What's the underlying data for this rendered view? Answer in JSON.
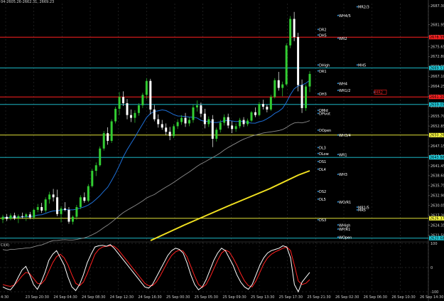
{
  "header": {
    "symbol_text": "04-2605.26-2662.31, 2669.23"
  },
  "subwindow": {
    "label": "CI(4)",
    "ticks": [
      "100",
      "0",
      "-100"
    ]
  },
  "colors": {
    "background": "#000000",
    "bull": "#32cd32",
    "bear": "#ffffff",
    "ma_fast": "#1e6fd6",
    "ma_slow": "#8c8c8c",
    "ma_long": "#f0e020",
    "red_line": "#ff2020",
    "cyan_line": "#20d0e0",
    "yellow_line": "#ffff40",
    "osc_main": "#ffffff",
    "osc_signal": "#ff2020"
  },
  "price_axis": {
    "max": 2688.0,
    "min": 2620.0,
    "ticks": [
      "2687.30",
      "2681.95",
      "2678.60",
      "2675.65",
      "2672.80",
      "2669.95",
      "2667.10",
      "2664.25",
      "2661.40",
      "2658.55",
      "2655.70",
      "2652.85",
      "2650.00",
      "2647.15",
      "2644.30",
      "2641.45",
      "2638.60",
      "2635.75",
      "2632.90",
      "2630.05",
      "2627.20",
      "2624.35",
      "2621.50"
    ],
    "marked": [
      {
        "label": "2678.35",
        "color": "#ff2020"
      },
      {
        "label": "2669.51",
        "color": "#20d0e0"
      },
      {
        "label": "2661.20",
        "color": "#ff2020"
      },
      {
        "label": "2659.05",
        "color": "#20d0e0"
      },
      {
        "label": "2650.26",
        "color": "#ffff40"
      },
      {
        "label": "2643.86",
        "color": "#20d0e0"
      },
      {
        "label": "2626.37",
        "color": "#ffff40"
      },
      {
        "label": "2620.68",
        "color": "#20d0e0"
      }
    ]
  },
  "time_axis": [
    "4:30",
    "23 Sep 20:30",
    "24 Sep 04:30",
    "24 Sep 08:30",
    "24 Sep 12:30",
    "24 Sep 16:30",
    "25 Sep 00:30",
    "25 Sep 05:30",
    "25 Sep 09:30",
    "25 Sep 13:30",
    "25 Sep 17:30",
    "25 Sep 21:30",
    "26 Sep 02:30",
    "26 Sep 06:30",
    "26 Sep 10:30",
    "26 Sep 14:30"
  ],
  "levels": [
    {
      "name": "WR2",
      "price": 2678.35,
      "color": "#ff2020",
      "label": "WR2"
    },
    {
      "name": "High",
      "price": 2669.51,
      "color": "#20d0e0",
      "label": "DHigh"
    },
    {
      "name": "R1",
      "price": 2661.2,
      "color": "#ff2020",
      "label": "DR1"
    },
    {
      "name": "cyan2",
      "price": 2659.05,
      "color": "#20d0e0",
      "label": "DH3"
    },
    {
      "name": "Open",
      "price": 2650.26,
      "color": "#ffff40",
      "label": "DOpen"
    },
    {
      "name": "WH3",
      "price": 2643.86,
      "color": "#20d0e0",
      "label": "WH3"
    },
    {
      "name": "yellow2",
      "price": 2626.37,
      "color": "#ffff40",
      "label": "DS3"
    },
    {
      "name": "WOpen",
      "price": 2620.68,
      "color": "#20d0e0",
      "label": "WOpen"
    }
  ],
  "annotations": [
    {
      "text": "WH4/5",
      "price": 2684.5,
      "col": "a",
      "color": "#ffffff"
    },
    {
      "text": "MR2/3",
      "price": 2687.0,
      "col": "c",
      "color": "#ffffff"
    },
    {
      "text": "DR2",
      "price": 2680.5,
      "col": "l",
      "color": "#ffffff"
    },
    {
      "text": "DH5",
      "price": 2678.9,
      "col": "l",
      "color": "#ffffff"
    },
    {
      "text": "WR2",
      "price": 2678.0,
      "col": "a",
      "color": "#ffffff"
    },
    {
      "text": "DHigh",
      "price": 2670.3,
      "col": "l",
      "color": "#ffffff"
    },
    {
      "text": "MH5",
      "price": 2670.3,
      "col": "c",
      "color": "#ffffff"
    },
    {
      "text": "DR1",
      "price": 2668.6,
      "col": "l",
      "color": "#ffffff"
    },
    {
      "text": "WH4",
      "price": 2665.0,
      "col": "a",
      "color": "#ffffff"
    },
    {
      "text": "WR1/2",
      "price": 2663.0,
      "col": "a",
      "color": "#ffffff"
    },
    {
      "text": "MR2",
      "price": 2662.5,
      "col": "d",
      "color": "#ff2020"
    },
    {
      "text": "DH3",
      "price": 2662.0,
      "col": "l",
      "color": "#ffffff"
    },
    {
      "text": "DMid",
      "price": 2657.3,
      "col": "l",
      "color": "#ffffff"
    },
    {
      "text": "DPivot",
      "price": 2656.4,
      "col": "l",
      "color": "#ffffff"
    },
    {
      "text": "DOpen",
      "price": 2651.6,
      "col": "l",
      "color": "#ffffff"
    },
    {
      "text": "WH3/4",
      "price": 2650.2,
      "col": "a",
      "color": "#ffffff"
    },
    {
      "text": "DL3",
      "price": 2646.6,
      "col": "l",
      "color": "#ffffff"
    },
    {
      "text": "DLow",
      "price": 2644.9,
      "col": "l",
      "color": "#ffffff"
    },
    {
      "text": "WR1",
      "price": 2644.6,
      "col": "a",
      "color": "#ffffff"
    },
    {
      "text": "DS1",
      "price": 2642.6,
      "col": "l",
      "color": "#ffffff"
    },
    {
      "text": "DL4",
      "price": 2640.4,
      "col": "l",
      "color": "#ffffff"
    },
    {
      "text": "WH3",
      "price": 2638.9,
      "col": "a",
      "color": "#ffffff"
    },
    {
      "text": "DS2",
      "price": 2634.0,
      "col": "l",
      "color": "#ffffff"
    },
    {
      "text": "DL5",
      "price": 2631.8,
      "col": "l",
      "color": "#ffffff"
    },
    {
      "text": "WO/R1",
      "price": 2631.0,
      "col": "a",
      "color": "#ffffff"
    },
    {
      "text": "MR1/5",
      "price": 2629.5,
      "col": "c",
      "color": "#ffffff"
    },
    {
      "text": "MR5",
      "price": 2628.7,
      "col": "c",
      "color": "#ffffff"
    },
    {
      "text": "DS3",
      "price": 2625.9,
      "col": "l",
      "color": "#ffffff"
    },
    {
      "text": "WHigh",
      "price": 2624.4,
      "col": "a",
      "color": "#ffffff"
    },
    {
      "text": "WP/R1",
      "price": 2623.2,
      "col": "a",
      "color": "#ffffff"
    },
    {
      "text": "WOpen",
      "price": 2620.9,
      "col": "a",
      "color": "#ffffff"
    }
  ],
  "candles": [
    [
      2626.0,
      2627.4,
      2625.0,
      2626.8
    ],
    [
      2626.8,
      2627.6,
      2625.6,
      2626.2
    ],
    [
      2626.2,
      2627.8,
      2625.8,
      2627.2
    ],
    [
      2627.2,
      2628.0,
      2625.9,
      2626.4
    ],
    [
      2626.4,
      2627.5,
      2625.0,
      2627.0
    ],
    [
      2627.0,
      2628.0,
      2626.3,
      2626.8
    ],
    [
      2626.8,
      2627.9,
      2625.6,
      2627.5
    ],
    [
      2627.5,
      2628.2,
      2626.1,
      2626.6
    ],
    [
      2626.6,
      2629.2,
      2626.0,
      2628.8
    ],
    [
      2628.8,
      2630.5,
      2628.1,
      2629.6
    ],
    [
      2629.6,
      2630.8,
      2627.9,
      2628.6
    ],
    [
      2628.6,
      2632.4,
      2628.0,
      2631.8
    ],
    [
      2631.8,
      2634.0,
      2630.6,
      2633.2
    ],
    [
      2633.2,
      2634.8,
      2631.2,
      2632.4
    ],
    [
      2632.4,
      2634.6,
      2627.0,
      2627.6
    ],
    [
      2627.6,
      2629.8,
      2625.2,
      2629.2
    ],
    [
      2629.2,
      2631.0,
      2628.4,
      2628.8
    ],
    [
      2628.8,
      2629.6,
      2624.8,
      2625.4
    ],
    [
      2625.4,
      2627.2,
      2624.6,
      2626.8
    ],
    [
      2626.8,
      2630.2,
      2626.0,
      2629.6
    ],
    [
      2629.6,
      2633.0,
      2629.0,
      2632.4
    ],
    [
      2632.4,
      2633.8,
      2630.8,
      2631.4
    ],
    [
      2631.4,
      2636.2,
      2631.0,
      2635.6
    ],
    [
      2635.6,
      2640.6,
      2635.2,
      2640.0
    ],
    [
      2640.0,
      2642.4,
      2638.5,
      2641.6
    ],
    [
      2641.6,
      2647.0,
      2641.2,
      2646.4
    ],
    [
      2646.4,
      2651.4,
      2645.8,
      2650.8
    ],
    [
      2650.8,
      2652.5,
      2647.5,
      2648.6
    ],
    [
      2648.6,
      2654.8,
      2648.0,
      2654.2
    ],
    [
      2654.2,
      2658.4,
      2653.6,
      2657.8
    ],
    [
      2657.8,
      2662.6,
      2656.0,
      2661.2
    ],
    [
      2661.2,
      2662.8,
      2658.6,
      2659.4
    ],
    [
      2659.4,
      2660.6,
      2654.8,
      2656.0
    ],
    [
      2656.0,
      2657.6,
      2654.0,
      2655.2
    ],
    [
      2655.2,
      2657.4,
      2653.8,
      2656.6
    ],
    [
      2656.6,
      2659.4,
      2655.8,
      2658.8
    ],
    [
      2658.8,
      2662.4,
      2658.0,
      2661.8
    ],
    [
      2661.8,
      2666.6,
      2660.6,
      2665.8
    ],
    [
      2665.8,
      2666.4,
      2656.2,
      2657.6
    ],
    [
      2657.6,
      2658.9,
      2654.2,
      2654.8
    ],
    [
      2654.8,
      2656.2,
      2652.4,
      2653.4
    ],
    [
      2653.4,
      2654.6,
      2651.8,
      2652.4
    ],
    [
      2652.4,
      2653.6,
      2650.2,
      2651.2
    ],
    [
      2651.2,
      2652.6,
      2648.8,
      2650.0
    ],
    [
      2650.0,
      2653.4,
      2649.4,
      2652.8
    ],
    [
      2652.8,
      2654.8,
      2652.0,
      2654.0
    ],
    [
      2654.0,
      2656.0,
      2653.2,
      2655.2
    ],
    [
      2655.2,
      2656.6,
      2652.6,
      2653.6
    ],
    [
      2653.6,
      2655.4,
      2652.8,
      2654.6
    ],
    [
      2654.6,
      2659.0,
      2653.8,
      2658.2
    ],
    [
      2658.2,
      2660.2,
      2657.0,
      2658.8
    ],
    [
      2658.8,
      2659.6,
      2655.4,
      2656.4
    ],
    [
      2656.4,
      2657.8,
      2652.2,
      2653.4
    ],
    [
      2653.4,
      2655.6,
      2652.6,
      2654.8
    ],
    [
      2654.8,
      2656.0,
      2646.8,
      2649.2
    ],
    [
      2649.2,
      2652.4,
      2648.4,
      2651.8
    ],
    [
      2651.8,
      2654.6,
      2651.0,
      2653.8
    ],
    [
      2653.8,
      2656.2,
      2653.0,
      2655.4
    ],
    [
      2655.4,
      2656.4,
      2652.2,
      2653.0
    ],
    [
      2653.0,
      2654.2,
      2650.8,
      2652.0
    ],
    [
      2652.0,
      2653.6,
      2651.2,
      2652.8
    ],
    [
      2652.8,
      2655.2,
      2652.2,
      2654.6
    ],
    [
      2654.6,
      2655.4,
      2652.6,
      2653.4
    ],
    [
      2653.4,
      2655.0,
      2652.8,
      2654.4
    ],
    [
      2654.4,
      2657.2,
      2654.0,
      2656.8
    ],
    [
      2656.8,
      2658.2,
      2655.4,
      2656.0
    ],
    [
      2656.0,
      2659.8,
      2655.6,
      2659.2
    ],
    [
      2659.2,
      2660.4,
      2657.6,
      2658.4
    ],
    [
      2658.4,
      2659.0,
      2656.8,
      2657.6
    ],
    [
      2657.6,
      2661.8,
      2657.2,
      2661.2
    ],
    [
      2661.2,
      2666.6,
      2660.8,
      2666.0
    ],
    [
      2666.0,
      2668.4,
      2663.0,
      2663.8
    ],
    [
      2663.8,
      2665.6,
      2661.4,
      2664.8
    ],
    [
      2664.8,
      2676.6,
      2664.4,
      2676.0
    ],
    [
      2676.0,
      2684.4,
      2675.2,
      2683.6
    ],
    [
      2683.6,
      2685.6,
      2677.2,
      2678.4
    ],
    [
      2678.4,
      2679.6,
      2662.8,
      2664.6
    ],
    [
      2664.6,
      2666.2,
      2656.6,
      2658.0
    ],
    [
      2658.0,
      2664.8,
      2657.2,
      2664.2
    ],
    [
      2664.2,
      2668.6,
      2662.6,
      2667.8
    ]
  ],
  "osc": [
    -80,
    -88,
    -92,
    -72,
    -40,
    -10,
    5,
    -30,
    -70,
    -90,
    -60,
    -20,
    30,
    55,
    70,
    40,
    10,
    -40,
    -80,
    -95,
    -70,
    -30,
    20,
    55,
    85,
    90,
    92,
    88,
    95,
    80,
    60,
    40,
    20,
    0,
    -20,
    -40,
    -60,
    -80,
    -85,
    -70,
    -40,
    -10,
    20,
    50,
    70,
    80,
    75,
    60,
    20,
    -30,
    -70,
    -92,
    -80,
    -50,
    -10,
    30,
    60,
    80,
    70,
    40,
    10,
    -30,
    -60,
    -80,
    -90,
    -70,
    -30,
    10,
    40,
    60,
    70,
    75,
    80,
    90,
    85,
    40,
    -70,
    -100,
    -60,
    -40,
    -20
  ],
  "osc_signal": [
    -70,
    -75,
    -78,
    -72,
    -55,
    -35,
    -20,
    -25,
    -45,
    -65,
    -68,
    -50,
    -15,
    20,
    45,
    55,
    40,
    10,
    -30,
    -65,
    -75,
    -60,
    -25,
    15,
    55,
    75,
    85,
    88,
    90,
    88,
    75,
    55,
    35,
    15,
    -5,
    -25,
    -45,
    -65,
    -75,
    -75,
    -60,
    -35,
    -5,
    25,
    50,
    65,
    72,
    68,
    45,
    5,
    -35,
    -70,
    -82,
    -70,
    -40,
    -5,
    30,
    60,
    72,
    65,
    40,
    10,
    -25,
    -55,
    -75,
    -80,
    -55,
    -20,
    15,
    40,
    55,
    65,
    72,
    80,
    85,
    70,
    10,
    -55,
    -70,
    -65,
    -50
  ]
}
